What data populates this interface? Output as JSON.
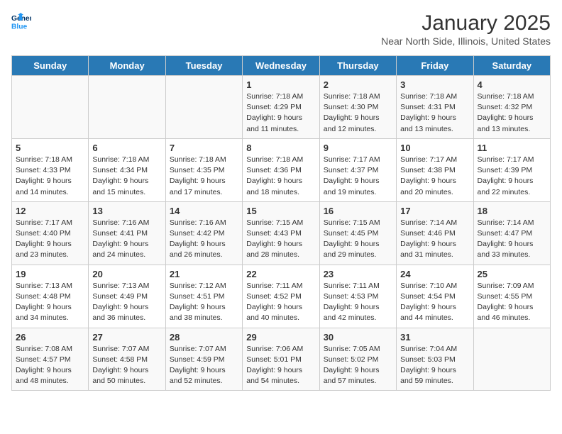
{
  "header": {
    "logo_line1": "General",
    "logo_line2": "Blue",
    "title": "January 2025",
    "subtitle": "Near North Side, Illinois, United States"
  },
  "weekdays": [
    "Sunday",
    "Monday",
    "Tuesday",
    "Wednesday",
    "Thursday",
    "Friday",
    "Saturday"
  ],
  "weeks": [
    [
      {
        "day": "",
        "content": ""
      },
      {
        "day": "",
        "content": ""
      },
      {
        "day": "",
        "content": ""
      },
      {
        "day": "1",
        "content": "Sunrise: 7:18 AM\nSunset: 4:29 PM\nDaylight: 9 hours\nand 11 minutes."
      },
      {
        "day": "2",
        "content": "Sunrise: 7:18 AM\nSunset: 4:30 PM\nDaylight: 9 hours\nand 12 minutes."
      },
      {
        "day": "3",
        "content": "Sunrise: 7:18 AM\nSunset: 4:31 PM\nDaylight: 9 hours\nand 13 minutes."
      },
      {
        "day": "4",
        "content": "Sunrise: 7:18 AM\nSunset: 4:32 PM\nDaylight: 9 hours\nand 13 minutes."
      }
    ],
    [
      {
        "day": "5",
        "content": "Sunrise: 7:18 AM\nSunset: 4:33 PM\nDaylight: 9 hours\nand 14 minutes."
      },
      {
        "day": "6",
        "content": "Sunrise: 7:18 AM\nSunset: 4:34 PM\nDaylight: 9 hours\nand 15 minutes."
      },
      {
        "day": "7",
        "content": "Sunrise: 7:18 AM\nSunset: 4:35 PM\nDaylight: 9 hours\nand 17 minutes."
      },
      {
        "day": "8",
        "content": "Sunrise: 7:18 AM\nSunset: 4:36 PM\nDaylight: 9 hours\nand 18 minutes."
      },
      {
        "day": "9",
        "content": "Sunrise: 7:17 AM\nSunset: 4:37 PM\nDaylight: 9 hours\nand 19 minutes."
      },
      {
        "day": "10",
        "content": "Sunrise: 7:17 AM\nSunset: 4:38 PM\nDaylight: 9 hours\nand 20 minutes."
      },
      {
        "day": "11",
        "content": "Sunrise: 7:17 AM\nSunset: 4:39 PM\nDaylight: 9 hours\nand 22 minutes."
      }
    ],
    [
      {
        "day": "12",
        "content": "Sunrise: 7:17 AM\nSunset: 4:40 PM\nDaylight: 9 hours\nand 23 minutes."
      },
      {
        "day": "13",
        "content": "Sunrise: 7:16 AM\nSunset: 4:41 PM\nDaylight: 9 hours\nand 24 minutes."
      },
      {
        "day": "14",
        "content": "Sunrise: 7:16 AM\nSunset: 4:42 PM\nDaylight: 9 hours\nand 26 minutes."
      },
      {
        "day": "15",
        "content": "Sunrise: 7:15 AM\nSunset: 4:43 PM\nDaylight: 9 hours\nand 28 minutes."
      },
      {
        "day": "16",
        "content": "Sunrise: 7:15 AM\nSunset: 4:45 PM\nDaylight: 9 hours\nand 29 minutes."
      },
      {
        "day": "17",
        "content": "Sunrise: 7:14 AM\nSunset: 4:46 PM\nDaylight: 9 hours\nand 31 minutes."
      },
      {
        "day": "18",
        "content": "Sunrise: 7:14 AM\nSunset: 4:47 PM\nDaylight: 9 hours\nand 33 minutes."
      }
    ],
    [
      {
        "day": "19",
        "content": "Sunrise: 7:13 AM\nSunset: 4:48 PM\nDaylight: 9 hours\nand 34 minutes."
      },
      {
        "day": "20",
        "content": "Sunrise: 7:13 AM\nSunset: 4:49 PM\nDaylight: 9 hours\nand 36 minutes."
      },
      {
        "day": "21",
        "content": "Sunrise: 7:12 AM\nSunset: 4:51 PM\nDaylight: 9 hours\nand 38 minutes."
      },
      {
        "day": "22",
        "content": "Sunrise: 7:11 AM\nSunset: 4:52 PM\nDaylight: 9 hours\nand 40 minutes."
      },
      {
        "day": "23",
        "content": "Sunrise: 7:11 AM\nSunset: 4:53 PM\nDaylight: 9 hours\nand 42 minutes."
      },
      {
        "day": "24",
        "content": "Sunrise: 7:10 AM\nSunset: 4:54 PM\nDaylight: 9 hours\nand 44 minutes."
      },
      {
        "day": "25",
        "content": "Sunrise: 7:09 AM\nSunset: 4:55 PM\nDaylight: 9 hours\nand 46 minutes."
      }
    ],
    [
      {
        "day": "26",
        "content": "Sunrise: 7:08 AM\nSunset: 4:57 PM\nDaylight: 9 hours\nand 48 minutes."
      },
      {
        "day": "27",
        "content": "Sunrise: 7:07 AM\nSunset: 4:58 PM\nDaylight: 9 hours\nand 50 minutes."
      },
      {
        "day": "28",
        "content": "Sunrise: 7:07 AM\nSunset: 4:59 PM\nDaylight: 9 hours\nand 52 minutes."
      },
      {
        "day": "29",
        "content": "Sunrise: 7:06 AM\nSunset: 5:01 PM\nDaylight: 9 hours\nand 54 minutes."
      },
      {
        "day": "30",
        "content": "Sunrise: 7:05 AM\nSunset: 5:02 PM\nDaylight: 9 hours\nand 57 minutes."
      },
      {
        "day": "31",
        "content": "Sunrise: 7:04 AM\nSunset: 5:03 PM\nDaylight: 9 hours\nand 59 minutes."
      },
      {
        "day": "",
        "content": ""
      }
    ]
  ]
}
